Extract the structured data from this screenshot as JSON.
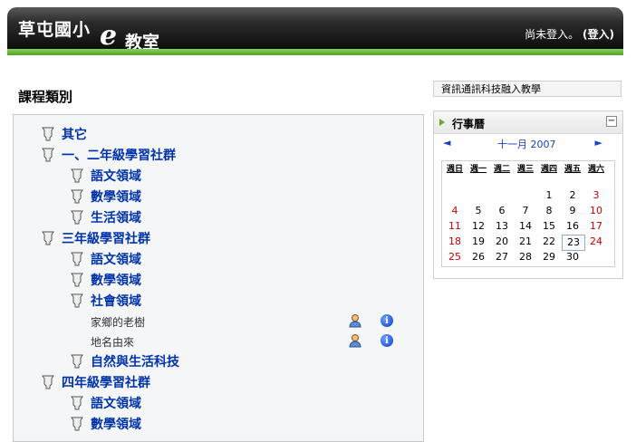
{
  "header": {
    "logo_main": "草屯國小",
    "logo_e": "e",
    "logo_sub": "教室",
    "login_prefix": "尚未登入。",
    "login_link": "(登入)"
  },
  "categories": {
    "title": "課程類別",
    "items": [
      {
        "label": "其它"
      },
      {
        "label": "一、二年級學習社群"
      },
      {
        "label": "語文領域"
      },
      {
        "label": "數學領域"
      },
      {
        "label": "生活領域"
      },
      {
        "label": "三年級學習社群"
      },
      {
        "label": "語文領域"
      },
      {
        "label": "數學領域"
      },
      {
        "label": "社會領域"
      },
      {
        "label": "自然與生活科技"
      },
      {
        "label": "四年級學習社群"
      },
      {
        "label": "語文領域"
      },
      {
        "label": "數學領域"
      }
    ],
    "courses": [
      {
        "label": "家鄉的老樹"
      },
      {
        "label": "地名由來"
      }
    ],
    "info_glyph": "i"
  },
  "topic": {
    "label": "資訊通訊科技融入教學"
  },
  "calendar": {
    "title": "行事曆",
    "collapse": "−",
    "prev": "◄",
    "month": "十一月 2007",
    "next": "►",
    "weekdays": [
      "週日",
      "週一",
      "週二",
      "週三",
      "週四",
      "週五",
      "週六"
    ],
    "days": {
      "d1": "1",
      "d2": "2",
      "d3": "3",
      "d4": "4",
      "d5": "5",
      "d6": "6",
      "d7": "7",
      "d8": "8",
      "d9": "9",
      "d10": "10",
      "d11": "11",
      "d12": "12",
      "d13": "13",
      "d14": "14",
      "d15": "15",
      "d16": "16",
      "d17": "17",
      "d18": "18",
      "d19": "19",
      "d20": "20",
      "d21": "21",
      "d22": "22",
      "d23": "23",
      "d24": "24",
      "d25": "25",
      "d26": "26",
      "d27": "27",
      "d28": "28",
      "d29": "29",
      "d30": "30"
    },
    "today": "23"
  }
}
